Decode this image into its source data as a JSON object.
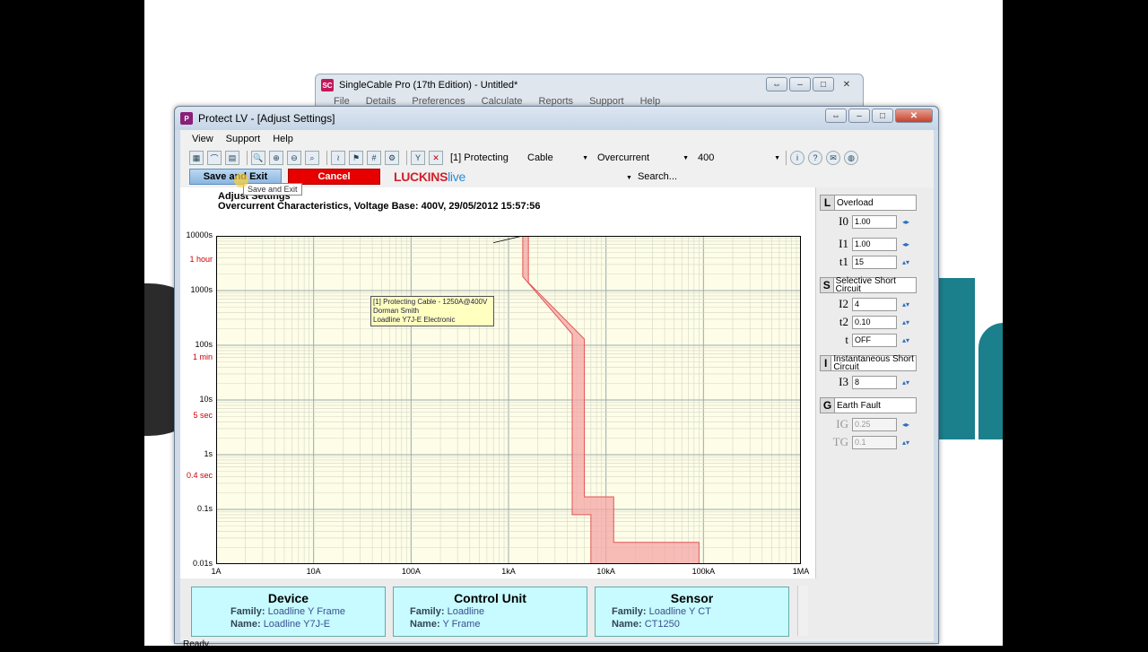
{
  "back_window": {
    "title": "SingleCable Pro (17th Edition)  - Untitled*",
    "menu": [
      "File",
      "Details",
      "Preferences",
      "Calculate",
      "Reports",
      "Support",
      "Help"
    ]
  },
  "window": {
    "title": "Protect LV - [Adjust Settings]",
    "icon_label": "P"
  },
  "menu": [
    "View",
    "Support",
    "Help"
  ],
  "toolbar": {
    "protecting_label": "[1] Protecting",
    "cable_value": "Cable",
    "mode_value": "Overcurrent",
    "voltage_value": "400"
  },
  "actions": {
    "save_label": "Save and Exit",
    "cancel_label": "Cancel",
    "logo_main": "LUCKINS",
    "logo_sub": "live",
    "search_label": "Search..."
  },
  "tooltip": "Save and Exit",
  "graph": {
    "subtitle": "Adjust Settings",
    "title": "Overcurrent Characteristics, Voltage Base: 400V, 29/05/2012 15:57:56",
    "annotation": [
      "[1] Protecting   Cable - 1250A@400V",
      "Dorman Smith",
      "Loadline Y7J-E Electronic"
    ]
  },
  "chart_data": {
    "type": "line",
    "title": "Overcurrent Characteristics, Voltage Base: 400V, 29/05/2012 15:57:56",
    "x_scale": "log",
    "y_scale": "log",
    "xlim": [
      1,
      1000000
    ],
    "ylim": [
      0.01,
      10000
    ],
    "x_ticks": [
      {
        "value": 1,
        "label": "1A"
      },
      {
        "value": 10,
        "label": "10A"
      },
      {
        "value": 100,
        "label": "100A"
      },
      {
        "value": 1000,
        "label": "1kA"
      },
      {
        "value": 10000,
        "label": "10kA"
      },
      {
        "value": 100000,
        "label": "100kA"
      },
      {
        "value": 1000000,
        "label": "1MA"
      }
    ],
    "y_ticks": [
      {
        "value": 10000,
        "label": "10000s",
        "color": "#000000"
      },
      {
        "value": 3600,
        "label": "1 hour",
        "color": "#cc0000"
      },
      {
        "value": 1000,
        "label": "1000s",
        "color": "#000000"
      },
      {
        "value": 100,
        "label": "100s",
        "color": "#000000"
      },
      {
        "value": 60,
        "label": "1 min",
        "color": "#cc0000"
      },
      {
        "value": 10,
        "label": "10s",
        "color": "#000000"
      },
      {
        "value": 5,
        "label": "5 sec",
        "color": "#cc0000"
      },
      {
        "value": 1,
        "label": "1s",
        "color": "#000000"
      },
      {
        "value": 0.4,
        "label": "0.4 sec",
        "color": "#cc0000"
      },
      {
        "value": 0.1,
        "label": "0.1s",
        "color": "#000000"
      },
      {
        "value": 0.01,
        "label": "0.01s",
        "color": "#000000"
      }
    ],
    "band": {
      "color": "#f4a6a6",
      "left_edge": [
        [
          1400,
          10000
        ],
        [
          1400,
          1800
        ],
        [
          4500,
          160
        ],
        [
          4500,
          0.08
        ],
        [
          7000,
          0.08
        ],
        [
          7000,
          0.01
        ]
      ],
      "right_edge": [
        [
          1600,
          10000
        ],
        [
          1600,
          1400
        ],
        [
          6000,
          130
        ],
        [
          6000,
          0.17
        ],
        [
          12000,
          0.17
        ],
        [
          12000,
          0.025
        ],
        [
          90000,
          0.025
        ],
        [
          90000,
          0.01
        ]
      ]
    },
    "grid": true,
    "background": "#fdfde8"
  },
  "settings": {
    "overload": {
      "letter": "L",
      "name": "Overload",
      "i0_label": "I0",
      "i0": "1.00",
      "i1_label": "I1",
      "i1": "1.00",
      "t1_label": "t1",
      "t1": "15"
    },
    "selective": {
      "letter": "S",
      "name": "Selective Short Circuit",
      "i2_label": "I2",
      "i2": "4",
      "t2_label": "t2",
      "t2": "0.10",
      "t_label": "t",
      "t": "OFF"
    },
    "instantaneous": {
      "letter": "I",
      "name": "Instantaneous Short Circuit",
      "i3_label": "I3",
      "i3": "8"
    },
    "earth": {
      "letter": "G",
      "name": "Earth Fault",
      "ig_label": "IG",
      "ig": "0.25",
      "tg_label": "TG",
      "tg": "0.1"
    }
  },
  "cards": [
    {
      "title": "Device",
      "family_label": "Family:",
      "family": "Loadline Y Frame",
      "name_label": "Name:",
      "name": "Loadline Y7J-E"
    },
    {
      "title": "Control Unit",
      "family_label": "Family:",
      "family": "Loadline",
      "name_label": "Name:",
      "name": "Y Frame"
    },
    {
      "title": "Sensor",
      "family_label": "Family:",
      "family": "Loadline Y CT",
      "name_label": "Name:",
      "name": "CT1250"
    }
  ],
  "status": "Ready..."
}
